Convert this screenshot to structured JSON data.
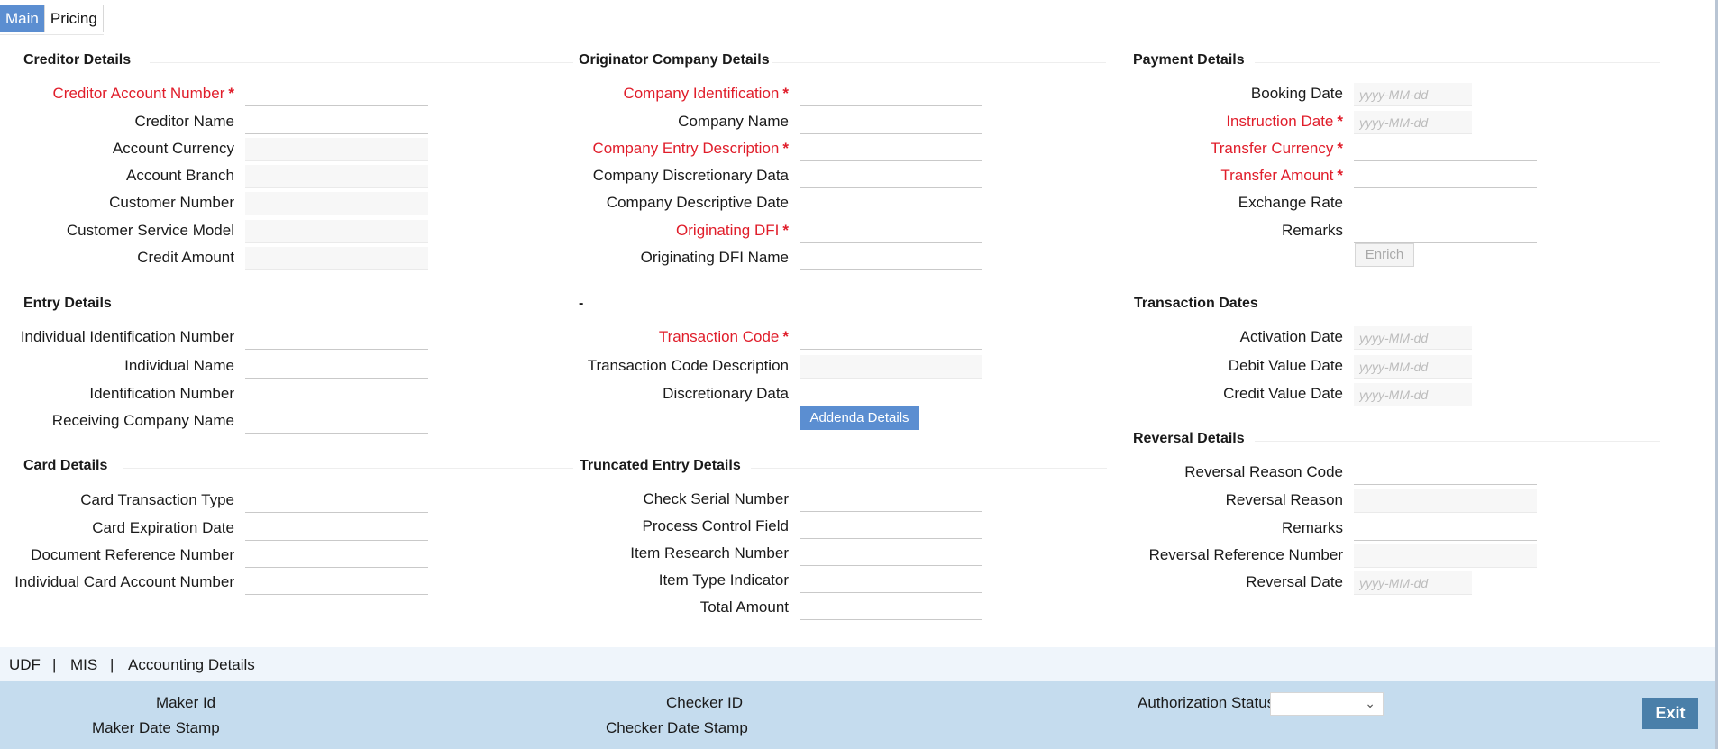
{
  "tabs": [
    {
      "label": "Main",
      "active": true
    },
    {
      "label": "Pricing",
      "active": false
    }
  ],
  "required_marker": "*",
  "date_placeholder": "yyyy-MM-dd",
  "creditor": {
    "title": "Creditor Details",
    "fields": [
      {
        "label": "Creditor Account Number",
        "required": true,
        "value": ""
      },
      {
        "label": "Creditor Name",
        "value": ""
      },
      {
        "label": "Account Currency",
        "value": ""
      },
      {
        "label": "Account Branch",
        "value": ""
      },
      {
        "label": "Customer Number",
        "value": ""
      },
      {
        "label": "Customer Service Model",
        "value": ""
      },
      {
        "label": "Credit Amount",
        "value": ""
      }
    ]
  },
  "originator": {
    "title": "Originator Company Details",
    "fields": [
      {
        "label": "Company Identification",
        "required": true,
        "value": ""
      },
      {
        "label": "Company Name",
        "value": ""
      },
      {
        "label": "Company Entry Description",
        "required": true,
        "value": ""
      },
      {
        "label": "Company Discretionary Data",
        "value": ""
      },
      {
        "label": "Company Descriptive Date",
        "value": ""
      },
      {
        "label": "Originating DFI",
        "required": true,
        "value": ""
      },
      {
        "label": "Originating DFI Name",
        "value": ""
      }
    ]
  },
  "payment": {
    "title": "Payment Details",
    "fields": [
      {
        "label": "Booking Date",
        "value": ""
      },
      {
        "label": "Instruction Date",
        "required": true,
        "value": ""
      },
      {
        "label": "Transfer Currency",
        "required": true,
        "value": ""
      },
      {
        "label": "Transfer Amount",
        "required": true,
        "value": ""
      },
      {
        "label": "Exchange Rate",
        "value": ""
      },
      {
        "label": "Remarks",
        "value": ""
      }
    ],
    "enrich_label": "Enrich"
  },
  "entry": {
    "title": "Entry Details",
    "fields": [
      {
        "label": "Individual Identification Number",
        "value": ""
      },
      {
        "label": "Individual Name",
        "value": ""
      },
      {
        "label": "Identification Number",
        "value": ""
      },
      {
        "label": "Receiving Company Name",
        "value": ""
      }
    ]
  },
  "transaction": {
    "title": "-",
    "fields": [
      {
        "label": "Transaction Code",
        "required": true,
        "value": ""
      },
      {
        "label": "Transaction Code Description",
        "value": ""
      },
      {
        "label": "Discretionary Data",
        "value": ""
      }
    ],
    "addenda_label": "Addenda Details"
  },
  "txn_dates": {
    "title": "Transaction Dates",
    "fields": [
      {
        "label": "Activation Date",
        "value": ""
      },
      {
        "label": "Debit Value Date",
        "value": ""
      },
      {
        "label": "Credit Value Date",
        "value": ""
      }
    ]
  },
  "reversal": {
    "title": "Reversal Details",
    "fields": [
      {
        "label": "Reversal Reason Code",
        "value": ""
      },
      {
        "label": "Reversal Reason",
        "value": ""
      },
      {
        "label": "Remarks",
        "value": ""
      },
      {
        "label": "Reversal Reference Number",
        "value": ""
      },
      {
        "label": "Reversal Date",
        "value": ""
      }
    ]
  },
  "card": {
    "title": "Card Details",
    "fields": [
      {
        "label": "Card Transaction Type",
        "value": ""
      },
      {
        "label": "Card Expiration Date",
        "value": ""
      },
      {
        "label": "Document Reference Number",
        "value": ""
      },
      {
        "label": "Individual Card Account Number",
        "value": ""
      }
    ]
  },
  "truncated": {
    "title": "Truncated Entry Details",
    "fields": [
      {
        "label": "Check Serial Number",
        "value": ""
      },
      {
        "label": "Process Control Field",
        "value": ""
      },
      {
        "label": "Item Research Number",
        "value": ""
      },
      {
        "label": "Item Type Indicator",
        "value": ""
      },
      {
        "label": "Total Amount",
        "value": ""
      }
    ]
  },
  "links": {
    "udf": "UDF",
    "sep": "|",
    "mis": "MIS",
    "accounting": "Accounting Details"
  },
  "footer": {
    "maker_id": "Maker Id",
    "maker_date": "Maker Date Stamp",
    "checker_id": "Checker ID",
    "checker_date": "Checker Date Stamp",
    "auth_status": "Authorization Status",
    "auth_status_value": "",
    "exit_label": "Exit"
  },
  "colors": {
    "accent": "#5b8ed1",
    "required": "#e01d2a",
    "footer_bg": "#c5dcee",
    "exit_bg": "#4a7fa9"
  }
}
